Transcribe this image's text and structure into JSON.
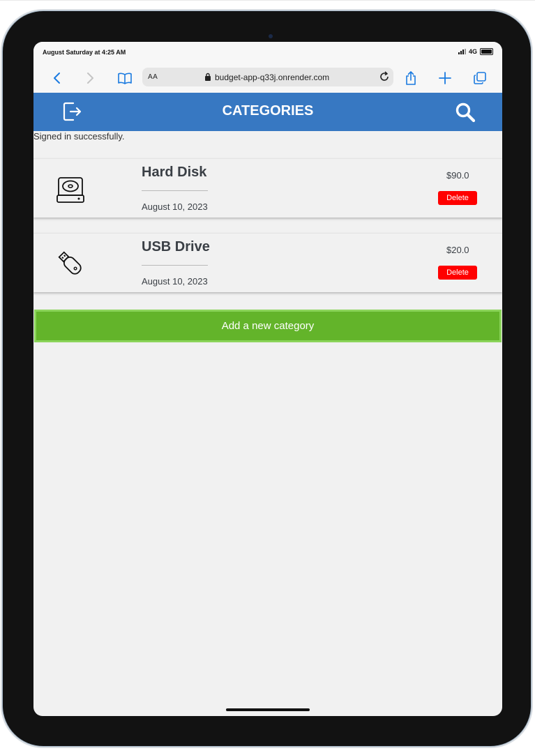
{
  "status_bar": {
    "time": "August Saturday at 4:25 AM",
    "network": "4G"
  },
  "browser": {
    "text_size_label": "AA",
    "url": "budget-app-q33j.onrender.com"
  },
  "header": {
    "title": "CATEGORIES"
  },
  "flash_notice": "Signed in successfully.",
  "categories": [
    {
      "name": "Hard Disk",
      "date": "August 10, 2023",
      "amount": "$90.0",
      "delete_label": "Delete",
      "icon": "hard-disk-icon"
    },
    {
      "name": "USB Drive",
      "date": "August 10, 2023",
      "amount": "$20.0",
      "delete_label": "Delete",
      "icon": "usb-drive-icon"
    }
  ],
  "add_button_label": "Add a new category",
  "colors": {
    "header": "#3778c2",
    "add_button": "#63b42a",
    "delete_button": "#ff0000",
    "screen_background": "#f1f1f1"
  }
}
